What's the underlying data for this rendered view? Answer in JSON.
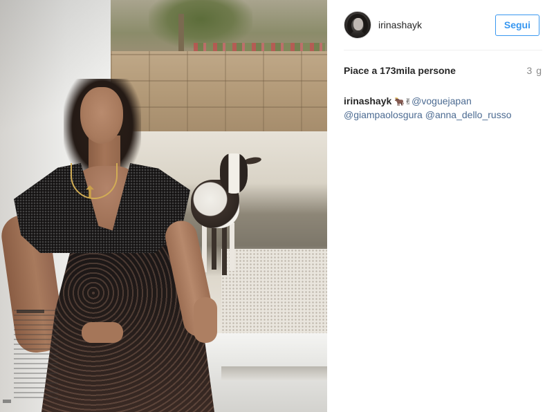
{
  "post": {
    "username": "irinashayk",
    "follow_label": "Segui",
    "likes_text": "Piace a 173mila persone",
    "time_ago": "3 g",
    "caption": {
      "user": "irinashayk",
      "emoji": "🐂✌",
      "mentions": [
        "@voguejapan",
        "@giampaolosgura",
        "@anna_dello_russo"
      ]
    }
  },
  "colors": {
    "accent": "#3897f0",
    "mention": "#4b6a91",
    "text": "#262626",
    "muted": "#8a8a8a",
    "divider": "#efefef"
  },
  "icons": {
    "avatar": "profile-photo"
  }
}
